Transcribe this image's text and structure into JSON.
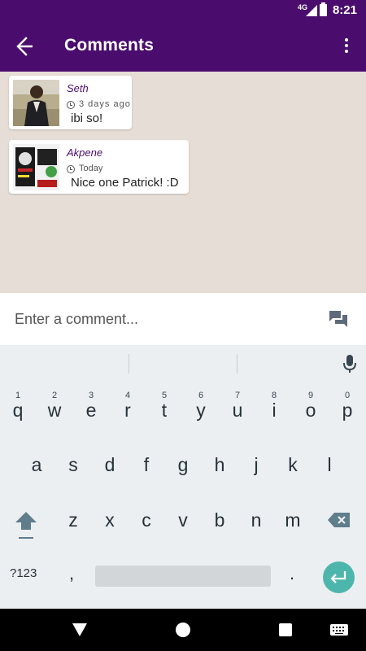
{
  "status_bar": {
    "network": "4G",
    "time": "8:21"
  },
  "app_bar": {
    "title": "Comments"
  },
  "comments": [
    {
      "author": "Seth",
      "time": "3 days ago",
      "text": "ibi so!"
    },
    {
      "author": "Akpene",
      "time": "Today",
      "text": "Nice one Patrick! :D"
    }
  ],
  "comment_input": {
    "placeholder": "Enter a comment...",
    "value": ""
  },
  "keyboard": {
    "row1": [
      {
        "hint": "1",
        "key": "q"
      },
      {
        "hint": "2",
        "key": "w"
      },
      {
        "hint": "3",
        "key": "e"
      },
      {
        "hint": "4",
        "key": "r"
      },
      {
        "hint": "5",
        "key": "t"
      },
      {
        "hint": "6",
        "key": "y"
      },
      {
        "hint": "7",
        "key": "u"
      },
      {
        "hint": "8",
        "key": "i"
      },
      {
        "hint": "9",
        "key": "o"
      },
      {
        "hint": "0",
        "key": "p"
      }
    ],
    "row2": [
      "a",
      "s",
      "d",
      "f",
      "g",
      "h",
      "j",
      "k",
      "l"
    ],
    "row3": [
      "z",
      "x",
      "c",
      "v",
      "b",
      "n",
      "m"
    ],
    "symbols_label": "?123",
    "comma": ",",
    "period": "."
  },
  "colors": {
    "primary": "#4a0d6e",
    "background": "#e6ddd6",
    "enter_key": "#4db6ac"
  }
}
